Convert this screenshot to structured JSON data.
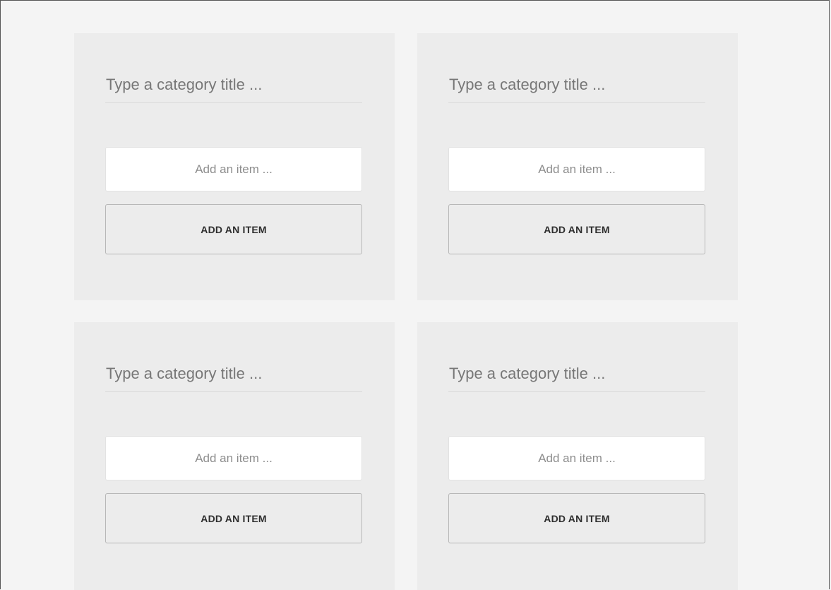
{
  "cards": [
    {
      "title_placeholder": "Type a category title ...",
      "item_placeholder": "Add an item ...",
      "add_button_label": "ADD AN ITEM"
    },
    {
      "title_placeholder": "Type a category title ...",
      "item_placeholder": "Add an item ...",
      "add_button_label": "ADD AN ITEM"
    },
    {
      "title_placeholder": "Type a category title ...",
      "item_placeholder": "Add an item ...",
      "add_button_label": "ADD AN ITEM"
    },
    {
      "title_placeholder": "Type a category title ...",
      "item_placeholder": "Add an item ...",
      "add_button_label": "ADD AN ITEM"
    }
  ],
  "colors": {
    "page_background": "#f4f4f4",
    "card_background": "#ececec",
    "input_background": "#ffffff",
    "button_text": "#2e2e2e"
  }
}
